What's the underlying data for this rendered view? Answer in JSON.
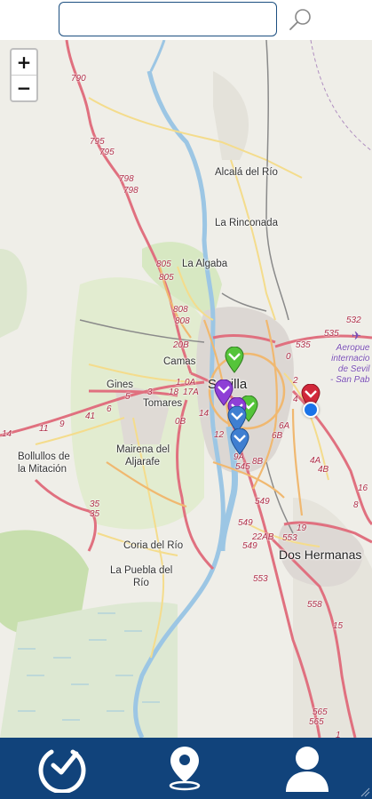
{
  "search": {
    "value": "",
    "placeholder": ""
  },
  "map": {
    "zoom_in_label": "+",
    "zoom_out_label": "−",
    "places": {
      "sevilla": "Sevilla",
      "dos_hermanas": "Dos Hermanas",
      "alcala": "Alcalá del Río",
      "la_rinconada": "La Rinconada",
      "la_algaba": "La Algaba",
      "camas": "Camas",
      "gines": "Gines",
      "tomares": "Tomares",
      "bollullos_1": "Bollullos de",
      "bollullos_2": "la Mitación",
      "mairena_1": "Mairena del",
      "mairena_2": "Aljarafe",
      "coria": "Coria del Río",
      "puebla_1": "La Puebla del",
      "puebla_2": "Río"
    },
    "airport": [
      "Aeropue",
      "internacio",
      "de Sevil",
      "- San Pab"
    ],
    "roads": [
      "790",
      "795",
      "795",
      "798",
      "798",
      "805",
      "805",
      "808",
      "808",
      "20B",
      "0A",
      "17A",
      "1",
      "3",
      "18",
      "5",
      "6",
      "41",
      "11",
      "9",
      "14",
      "14",
      "0B",
      "12",
      "9A",
      "545",
      "8B",
      "549",
      "549",
      "22AB",
      "549",
      "553",
      "19",
      "553",
      "558",
      "15",
      "565",
      "565",
      "6A",
      "6B",
      "4A",
      "4B",
      "535",
      "535",
      "532",
      "0",
      "2",
      "4",
      "16",
      "8",
      "35",
      "35",
      "1"
    ],
    "pin_colors": {
      "green": "#55c43a",
      "purple": "#8e3fd6",
      "blue": "#3f7fd1",
      "red": "#d1283a"
    }
  },
  "nav": {
    "items": [
      {
        "name": "logo-icon"
      },
      {
        "name": "location-pin-icon"
      },
      {
        "name": "user-icon"
      }
    ]
  }
}
